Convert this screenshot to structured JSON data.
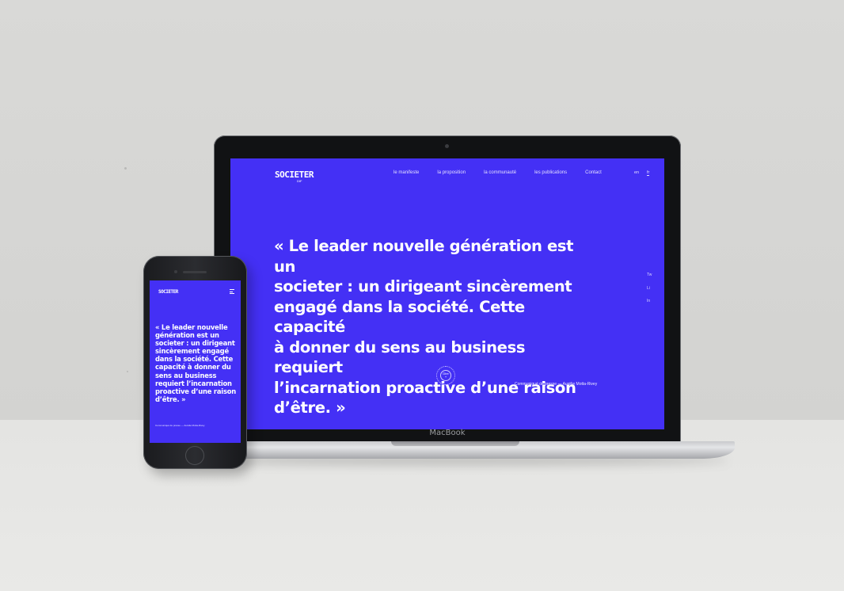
{
  "desktop_site": {
    "logo": "SOCIETER",
    "logo_sub": "DIF",
    "nav": [
      "le manifeste",
      "la proposition",
      "la communauté",
      "les publications",
      "Contact"
    ],
    "languages": [
      "en",
      "fr"
    ],
    "active_language": "fr",
    "quote_lines": [
      "« Le leader nouvelle génération est un",
      "societer : un dirigeant sincèrement",
      "engagé dans la société. Cette capacité",
      "à donner du sens au business requiert",
      "l’incarnation proactive d’une raison",
      "d’être. »"
    ],
    "social": [
      "Tw",
      "Li",
      "In"
    ],
    "seal_text": "Dire\n+",
    "credit": "Communiqué de presse  —  Aurélie Motta-Rivey"
  },
  "laptop": {
    "brand": "MacBook"
  },
  "mobile_site": {
    "logo": "SOCIETER",
    "quote_lines": [
      "« Le leader nouvelle",
      "génération est un",
      "societer : un dirigeant",
      "sincèrement engagé",
      "dans la société. Cette",
      "capacité à donner du",
      "sens au business",
      "requiert l’incarnation",
      "proactive d’une raison",
      "d’être. »"
    ],
    "credit": "Communiqué de presse  —  Aurélie Motta-Rivey"
  },
  "colors": {
    "brand_blue": "#4430f5",
    "wall": "#d7d7d5",
    "floor": "#e6e6e4"
  }
}
